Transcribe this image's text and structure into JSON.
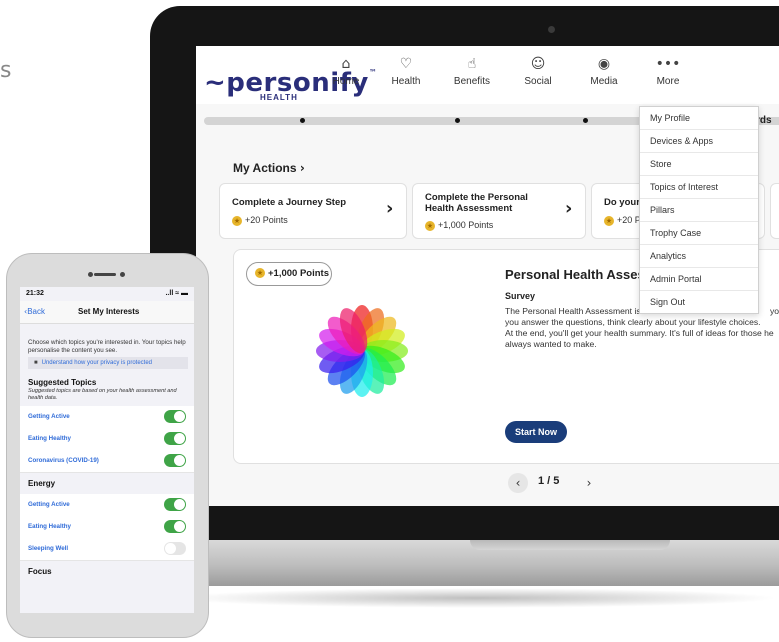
{
  "edge_text": "s",
  "web": {
    "logo": {
      "brand": "personify",
      "tm": "™",
      "sub": "HEALTH"
    },
    "nav": [
      {
        "label": "Home",
        "icon": "home-icon"
      },
      {
        "label": "Health",
        "icon": "heart-icon"
      },
      {
        "label": "Benefits",
        "icon": "hand-coins-icon"
      },
      {
        "label": "Social",
        "icon": "people-icon"
      },
      {
        "label": "Media",
        "icon": "play-icon"
      },
      {
        "label": "More",
        "icon": "more-dots-icon"
      }
    ],
    "rewards_fragment": "rds",
    "my_actions": "My Actions",
    "cards": [
      {
        "title": "Complete a Journey Step",
        "points": "+20 Points"
      },
      {
        "title": "Complete the Personal Health Assessment",
        "points": "+1,000 Points"
      },
      {
        "title": "Do your D",
        "points": "+20 Po"
      }
    ],
    "points_pill": "+1,000 Points",
    "assessment": {
      "title": "Personal Health Assess",
      "subtitle": "Survey",
      "body_line1": "The Personal Health Assessment is",
      "body_line1_end": "your",
      "body_line2": "you answer the questions, think clearly about your lifestyle choices.",
      "body_line3": "At the end, you'll get your health summary. It's full of ideas for those he",
      "body_line4": "always wanted to make.",
      "button": "Start Now"
    },
    "pager": "1 / 5",
    "menu": [
      "My Profile",
      "Devices & Apps",
      "Store",
      "Topics of Interest",
      "Pillars",
      "Trophy Case",
      "Analytics",
      "Admin Portal",
      "Sign Out"
    ]
  },
  "phone": {
    "time": "21:32",
    "status_right": "..ll ≈ ▬",
    "back": "Back",
    "title": "Set My Interests",
    "intro": "Choose which topics you're interested in. Your topics help personalise the content you see.",
    "privacy": "Understand how your privacy is protected",
    "suggested_heading": "Suggested Topics",
    "suggested_note": "Suggested topics are based on your health assessment and health data.",
    "suggested": [
      {
        "label": "Getting Active",
        "on": true
      },
      {
        "label": "Eating Healthy",
        "on": true
      },
      {
        "label": "Coronavirus (COVID-19)",
        "on": true
      }
    ],
    "energy_heading": "Energy",
    "energy": [
      {
        "label": "Getting Active",
        "on": true
      },
      {
        "label": "Eating Healthy",
        "on": true
      },
      {
        "label": "Sleeping Well",
        "on": false
      }
    ],
    "focus_heading": "Focus"
  }
}
